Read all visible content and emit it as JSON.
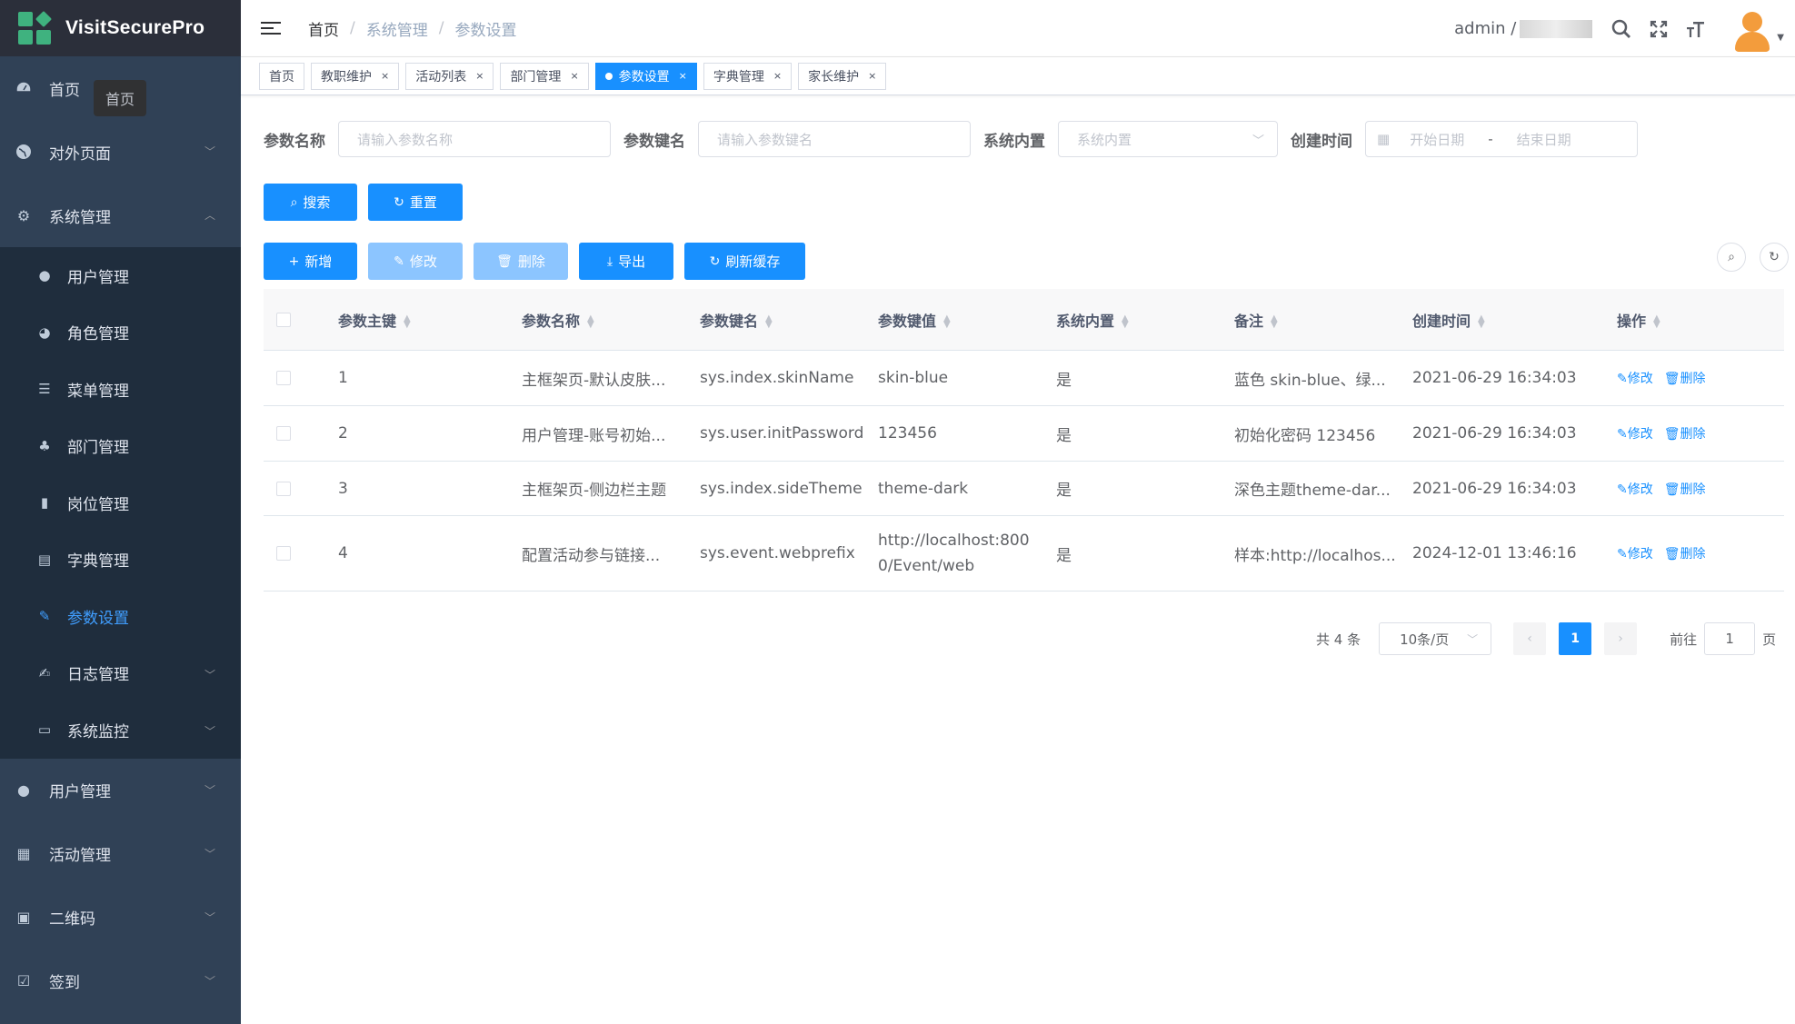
{
  "app": {
    "title": "VisitSecurePro"
  },
  "sidebar": {
    "tooltip": "首页",
    "items": [
      {
        "label": "首页",
        "icon": "dashboard-icon"
      },
      {
        "label": "对外页面",
        "icon": "globe-icon"
      },
      {
        "label": "系统管理",
        "icon": "gear-icon"
      }
    ],
    "sub_items": [
      {
        "label": "用户管理",
        "icon": "user-icon"
      },
      {
        "label": "角色管理",
        "icon": "peoples-icon"
      },
      {
        "label": "菜单管理",
        "icon": "tree-table-icon"
      },
      {
        "label": "部门管理",
        "icon": "tree-icon"
      },
      {
        "label": "岗位管理",
        "icon": "post-icon"
      },
      {
        "label": "字典管理",
        "icon": "dict-icon"
      },
      {
        "label": "参数设置",
        "icon": "edit-icon"
      },
      {
        "label": "日志管理",
        "icon": "log-icon"
      },
      {
        "label": "系统监控",
        "icon": "monitor-icon"
      }
    ],
    "bottom_items": [
      {
        "label": "用户管理",
        "icon": "user-icon"
      },
      {
        "label": "活动管理",
        "icon": "table-icon"
      },
      {
        "label": "二维码",
        "icon": "qrcode-icon"
      },
      {
        "label": "签到",
        "icon": "checkbox-icon"
      }
    ]
  },
  "header": {
    "breadcrumb": [
      "首页",
      "系统管理",
      "参数设置"
    ],
    "user": "admin /"
  },
  "tags": [
    "首页",
    "教职维护",
    "活动列表",
    "部门管理",
    "参数设置",
    "字典管理",
    "家长维护"
  ],
  "form": {
    "name_label": "参数名称",
    "name_placeholder": "请输入参数名称",
    "key_label": "参数键名",
    "key_placeholder": "请输入参数键名",
    "builtin_label": "系统内置",
    "builtin_placeholder": "系统内置",
    "time_label": "创建时间",
    "start_placeholder": "开始日期",
    "range_sep": "-",
    "end_placeholder": "结束日期"
  },
  "buttons": {
    "search": "搜索",
    "reset": "重置",
    "add": "新增",
    "edit": "修改",
    "delete": "删除",
    "export": "导出",
    "refresh_cache": "刷新缓存"
  },
  "table": {
    "columns": [
      "参数主键",
      "参数名称",
      "参数键名",
      "参数键值",
      "系统内置",
      "备注",
      "创建时间",
      "操作"
    ],
    "rows": [
      {
        "id": "1",
        "name": "主框架页-默认皮肤...",
        "key": "sys.index.skinName",
        "value": "skin-blue",
        "builtin": "是",
        "remark": "蓝色 skin-blue、绿...",
        "time": "2021-06-29 16:34:03"
      },
      {
        "id": "2",
        "name": "用户管理-账号初始...",
        "key": "sys.user.initPassword",
        "value": "123456",
        "builtin": "是",
        "remark": "初始化密码 123456",
        "time": "2021-06-29 16:34:03"
      },
      {
        "id": "3",
        "name": "主框架页-侧边栏主题",
        "key": "sys.index.sideTheme",
        "value": "theme-dark",
        "builtin": "是",
        "remark": "深色主题theme-dar...",
        "time": "2021-06-29 16:34:03"
      },
      {
        "id": "4",
        "name": "配置活动参与链接...",
        "key": "sys.event.webprefix",
        "value": "http://localhost:8000/Event/web",
        "builtin": "是",
        "remark": "样本:http://localhos...",
        "time": "2024-12-01 13:46:16"
      }
    ],
    "op_edit": "修改",
    "op_delete": "删除"
  },
  "pagination": {
    "total": "共 4 条",
    "page_size": "10条/页",
    "current": "1",
    "goto_label": "前往",
    "goto_value": "1",
    "page_suffix": "页"
  },
  "colors": {
    "primary": "#1890ff",
    "sidebar_bg": "#304156",
    "submenu_bg": "#1f2d3d",
    "active_text": "#409eff"
  }
}
